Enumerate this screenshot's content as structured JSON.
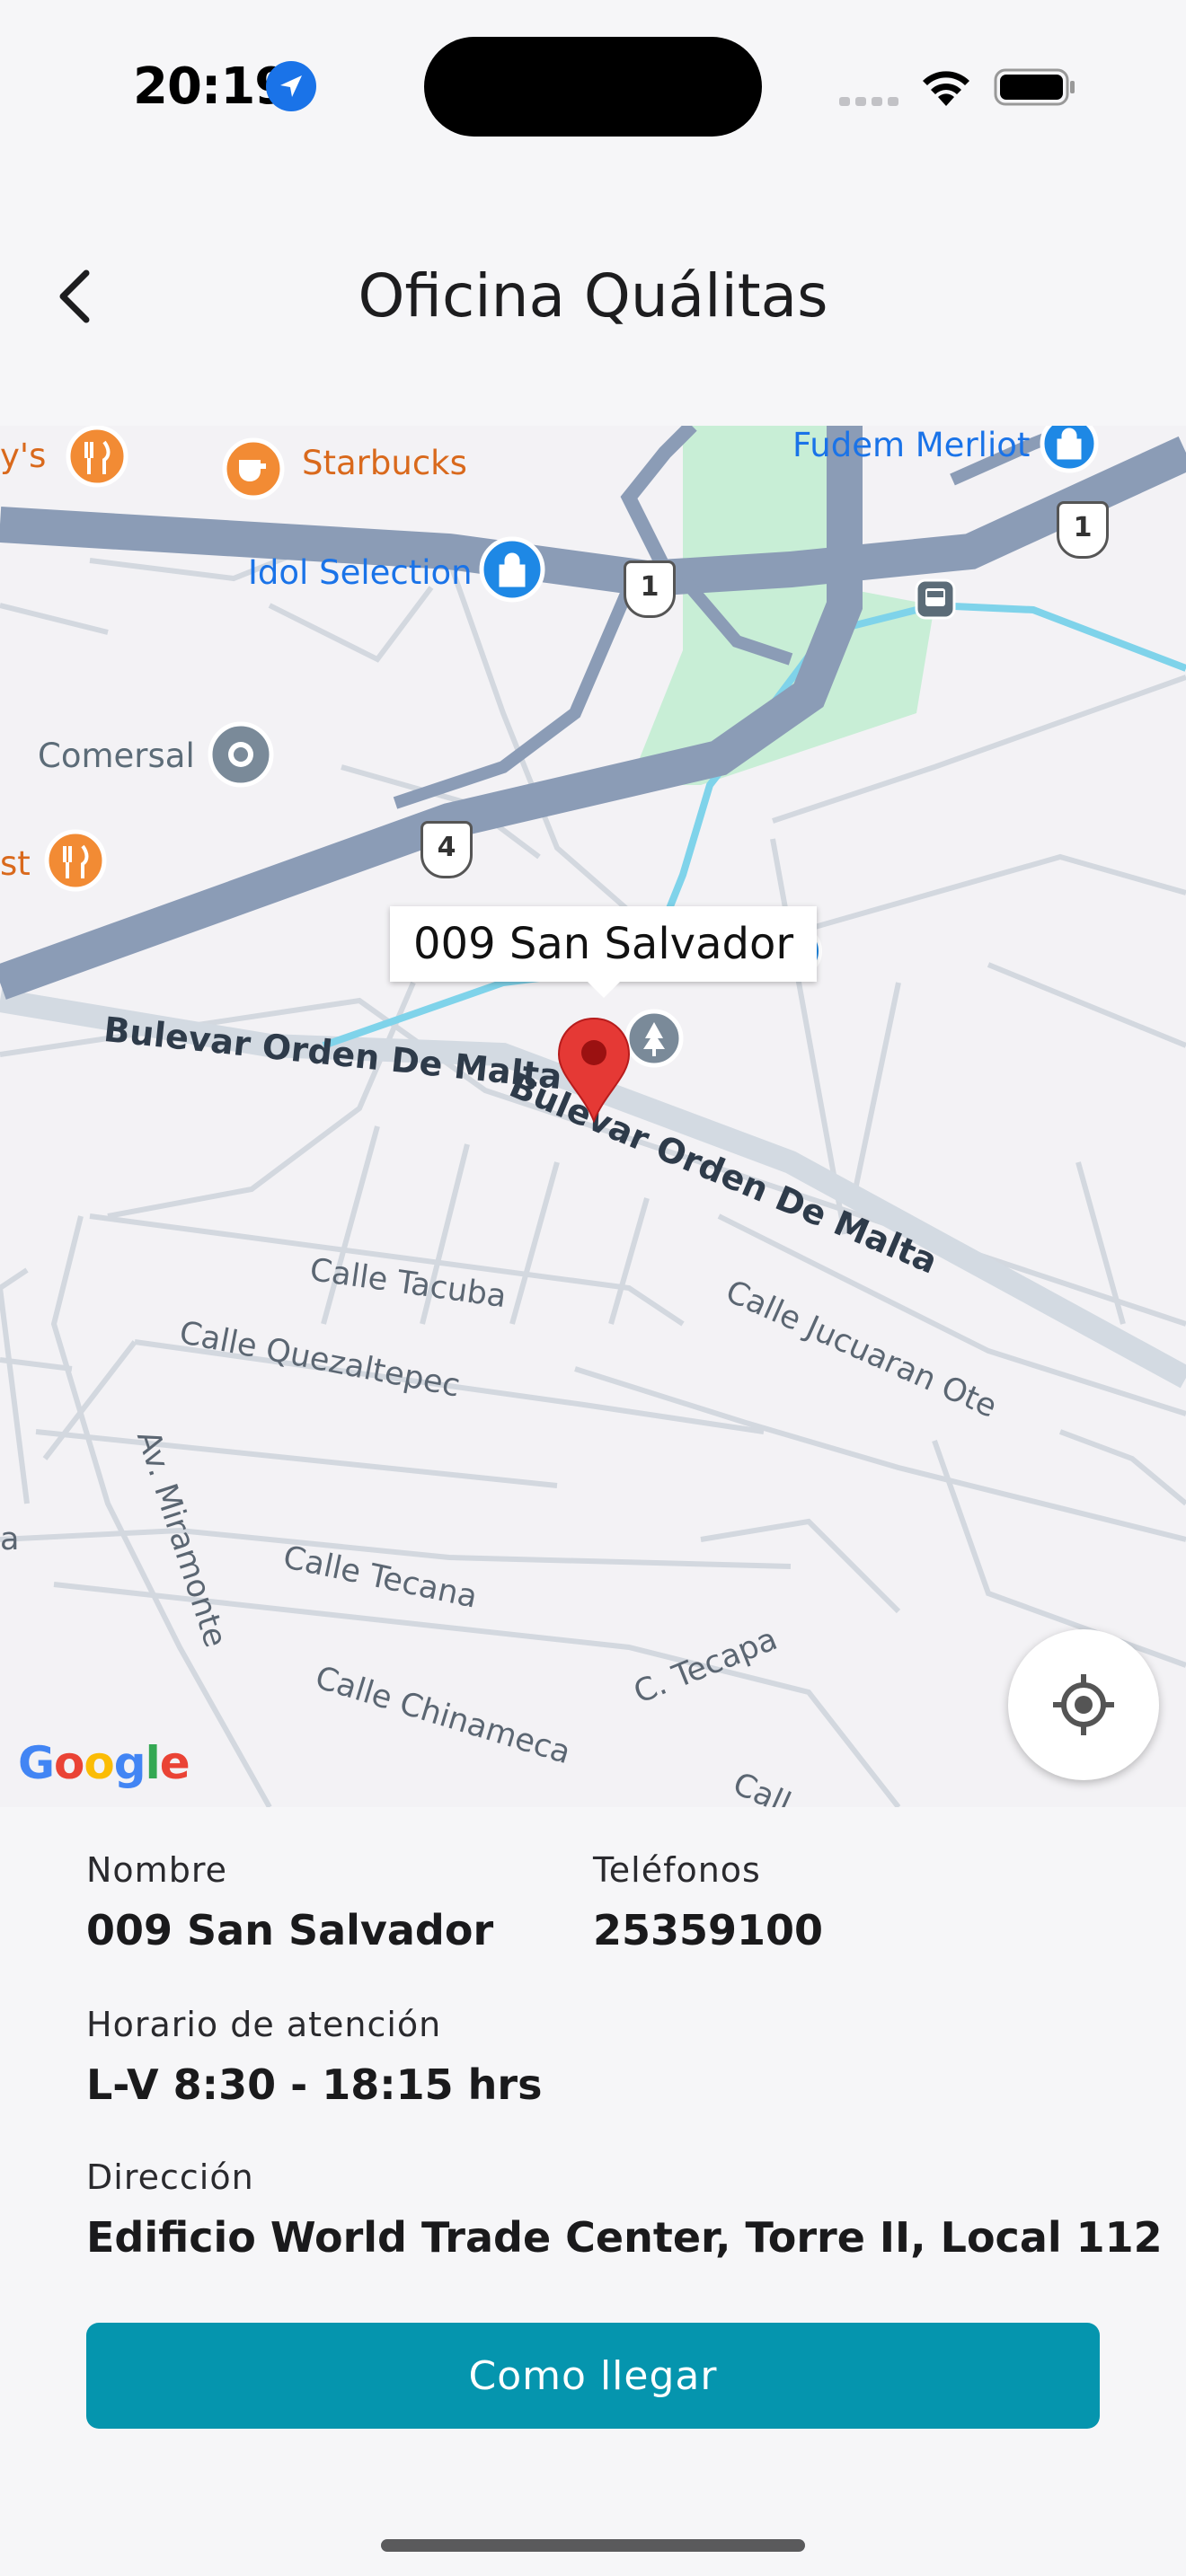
{
  "status_bar": {
    "time": "20:19"
  },
  "header": {
    "title": "Oficina Quálitas"
  },
  "map": {
    "callout": "009 San Salvador",
    "pois": {
      "ys": "y's",
      "starbucks": "Starbucks",
      "fudem": "Fudem Merliot",
      "idol": "Idol Selection",
      "comersal": "Comersal",
      "st": "st"
    },
    "route_shields": {
      "r1a": "1",
      "r1b": "1",
      "r4": "4"
    },
    "streets": {
      "orden_malta_1": "Bulevar Orden De Malta",
      "orden_malta_2": "Bulevar Orden De Malta",
      "tacuba": "Calle Tacuba",
      "quezaltepec": "Calle Quezaltepec",
      "jucuaran": "Calle Jucuaran Ote",
      "miramonte": "Av. Miramonte",
      "tecana": "Calle Tecana",
      "tecapa": "C. Tecapa",
      "chinameca": "Calle Chinameca",
      "call": "Call",
      "a": "a"
    },
    "attribution": "Google"
  },
  "info": {
    "nombre_label": "Nombre",
    "nombre_value": "009 San Salvador",
    "telefonos_label": "Teléfonos",
    "telefonos_value": "25359100",
    "horario_label": "Horario de atención",
    "horario_value": "L-V 8:30 - 18:15 hrs",
    "direccion_label": "Dirección",
    "direccion_value": "Edificio World Trade Center, Torre II, Local 112"
  },
  "cta": {
    "label": "Como llegar"
  },
  "colors": {
    "accent": "#0595ae",
    "pin": "#e53935",
    "highway": "#8b9cb6",
    "park": "#c8eed6",
    "water": "#7fd3ea"
  }
}
